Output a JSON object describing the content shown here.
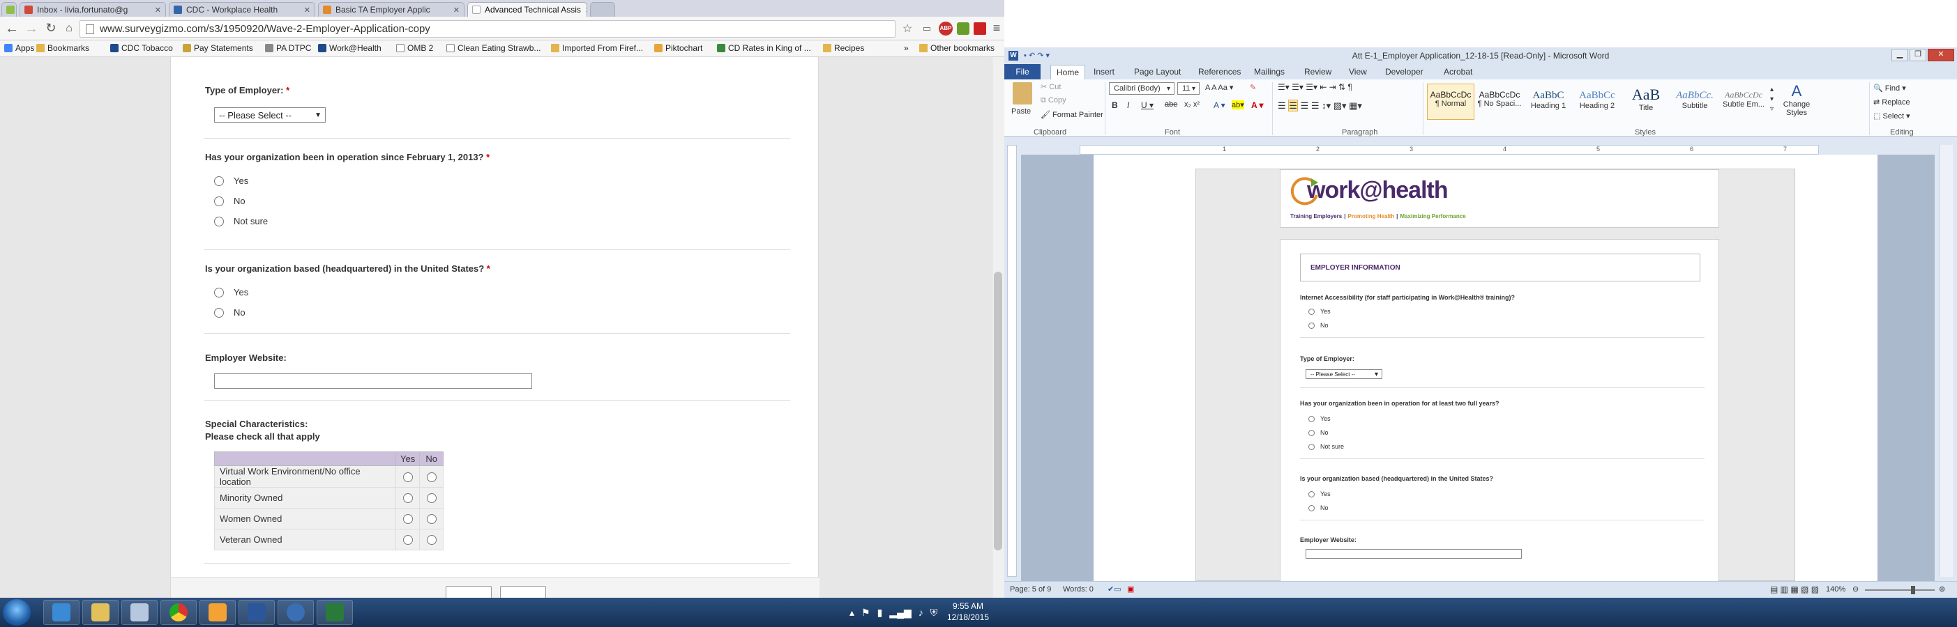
{
  "browser": {
    "tabs": [
      {
        "label": "",
        "color": "#8fbf4a"
      },
      {
        "label": "Inbox - livia.fortunato@g",
        "color": "#d04a3a"
      },
      {
        "label": "CDC - Workplace Health",
        "color": "#3366aa"
      },
      {
        "label": "Basic TA Employer Applic",
        "color": "#e38b2a"
      },
      {
        "label": "Advanced Technical Assis",
        "color": "#dddddd"
      }
    ],
    "url": "www.surveygizmo.com/s3/1950920/Wave-2-Employer-Application-copy",
    "bookmarks": [
      "Apps",
      "Bookmarks",
      "CDC Tobacco",
      "Pay Statements",
      "PA DTPC",
      "Work@Health",
      "OMB 2",
      "Clean Eating Strawb...",
      "Imported From Firef...",
      "Piktochart",
      "CD Rates in King of ...",
      "Recipes",
      "»",
      "Other bookmarks"
    ]
  },
  "form": {
    "q_type": "Type of Employer:",
    "req": "*",
    "select_placeholder": "-- Please Select --",
    "q_operation": "Has your organization been in operation since February 1, 2013?",
    "q_hq": "Is your organization based (headquartered) in the United States?",
    "opt_yes": "Yes",
    "opt_no": "No",
    "opt_notsure": "Not sure",
    "q_website": "Employer Website:",
    "q_special": "Special Characteristics:",
    "q_special_sub": "Please check all that apply",
    "grid_header": [
      "Yes",
      "No"
    ],
    "grid_rows": [
      "Virtual Work Environment/No office location",
      "Minority Owned",
      "Women Owned",
      "Veteran Owned"
    ]
  },
  "word": {
    "title": "Att E-1_Employer Application_12-18-15 [Read-Only] - Microsoft Word",
    "menus": [
      "File",
      "Home",
      "Insert",
      "Page Layout",
      "References",
      "Mailings",
      "Review",
      "View",
      "Developer",
      "Acrobat"
    ],
    "clipboard": {
      "paste": "Paste",
      "cut": "Cut",
      "copy": "Copy",
      "format_painter": "Format Painter",
      "group": "Clipboard"
    },
    "font": {
      "name": "Calibri (Body)",
      "size": "11",
      "group": "Font"
    },
    "paragraph_group": "Paragraph",
    "styles": [
      {
        "preview": "AaBbCcDc",
        "name": "¶ Normal"
      },
      {
        "preview": "AaBbCcDc",
        "name": "¶ No Spaci..."
      },
      {
        "preview": "AaBbC",
        "name": "Heading 1"
      },
      {
        "preview": "AaBbCc",
        "name": "Heading 2"
      },
      {
        "preview": "AaB",
        "name": "Title"
      },
      {
        "preview": "AaBbCc.",
        "name": "Subtitle"
      },
      {
        "preview": "AaBbCcDc",
        "name": "Subtle Em..."
      }
    ],
    "styles_group": "Styles",
    "change_styles": "Change Styles",
    "editing": {
      "find": "Find",
      "replace": "Replace",
      "select": "Select",
      "group": "Editing"
    },
    "ruler_marks": [
      "1",
      "2",
      "3",
      "4",
      "5",
      "6",
      "7"
    ],
    "logo": {
      "brand": "work@health",
      "tagline_a": "Training Employers",
      "tagline_b": "Promoting Health",
      "tagline_c": "Maximizing Performance",
      "sep": "|"
    },
    "section": "EMPLOYER INFORMATION",
    "q_internet": "Internet Accessibility (for staff participating in Work@Health® training)?",
    "q_type": "Type of Employer:",
    "select_placeholder": "-- Please Select --",
    "q_operation": "Has your organization been in operation for at least two full years?",
    "q_hq": "Is your organization based (headquartered) in the United States?",
    "q_website": "Employer Website:",
    "opt_yes": "Yes",
    "opt_no": "No",
    "opt_notsure": "Not sure",
    "status_page": "Page: 5 of 9",
    "status_words": "Words: 0",
    "zoom": "140%"
  },
  "taskbar": {
    "time": "9:55 AM",
    "date": "12/18/2015"
  }
}
